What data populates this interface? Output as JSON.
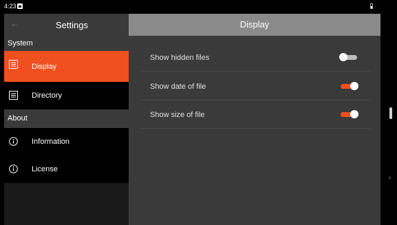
{
  "statusbar": {
    "time": "4:23"
  },
  "sidebar": {
    "title": "Settings",
    "sections": [
      {
        "label": "System"
      },
      {
        "label": "About"
      }
    ],
    "items": [
      {
        "label": "Display",
        "icon": "list-box-icon"
      },
      {
        "label": "Directory",
        "icon": "list-box-icon"
      },
      {
        "label": "Information",
        "icon": "info-circle-icon"
      },
      {
        "label": "License",
        "icon": "info-circle-icon"
      }
    ]
  },
  "main": {
    "title": "Display",
    "settings": [
      {
        "label": "Show hidden files",
        "enabled": false
      },
      {
        "label": "Show date of file",
        "enabled": true
      },
      {
        "label": "Show size of file",
        "enabled": true
      }
    ]
  },
  "colors": {
    "accent": "#f05020",
    "header": "#8a8a8a"
  }
}
